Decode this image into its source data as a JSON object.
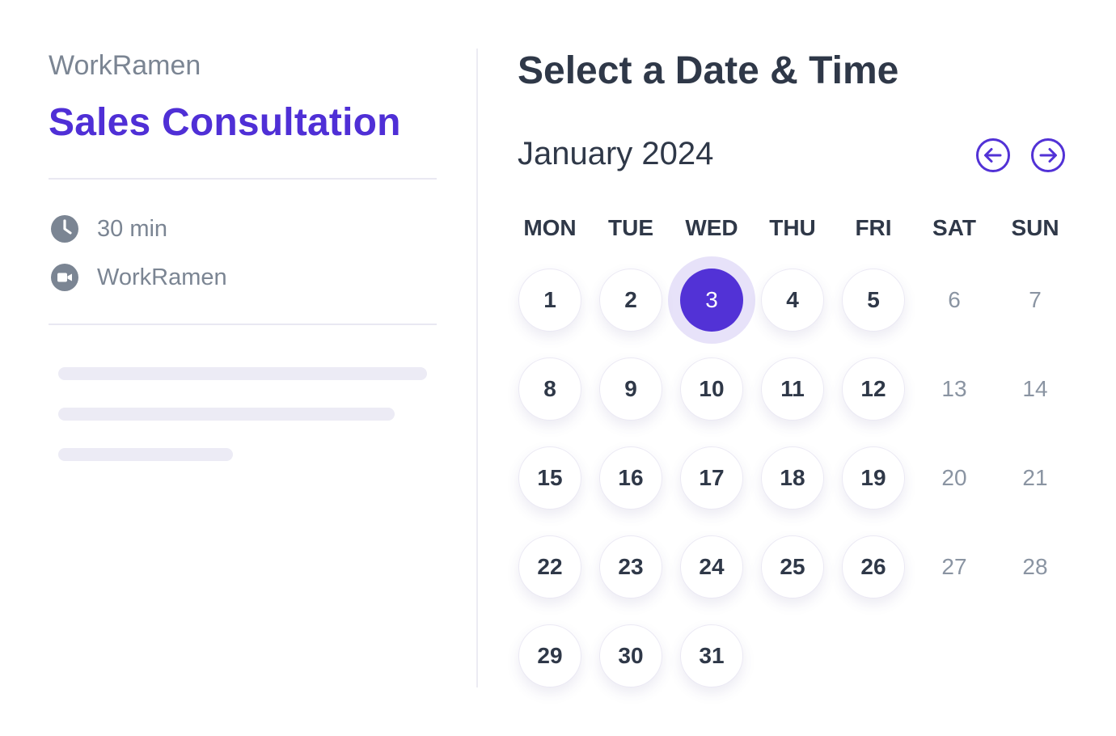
{
  "sidebar": {
    "organizer": "WorkRamen",
    "event_title": "Sales Consultation",
    "duration": "30 min",
    "location": "WorkRamen"
  },
  "main": {
    "heading": "Select a Date & Time",
    "month_label": "January 2024"
  },
  "calendar": {
    "weekdays": [
      "MON",
      "TUE",
      "WED",
      "THU",
      "FRI",
      "SAT",
      "SUN"
    ],
    "selected_day": "3",
    "weeks": [
      [
        "1",
        "2",
        "3",
        "4",
        "5",
        "6",
        "7"
      ],
      [
        "8",
        "9",
        "10",
        "11",
        "12",
        "13",
        "14"
      ],
      [
        "15",
        "16",
        "17",
        "18",
        "19",
        "20",
        "21"
      ],
      [
        "22",
        "23",
        "24",
        "25",
        "26",
        "27",
        "28"
      ],
      [
        "29",
        "30",
        "31"
      ]
    ]
  },
  "icons": {
    "duration": "clock-icon",
    "location": "video-camera-icon",
    "previous": "arrow-left-circle-icon",
    "next": "arrow-right-circle-icon"
  },
  "colors": {
    "accent": "#5232d6",
    "heading": "#2f3848",
    "muted": "#7b8593"
  }
}
